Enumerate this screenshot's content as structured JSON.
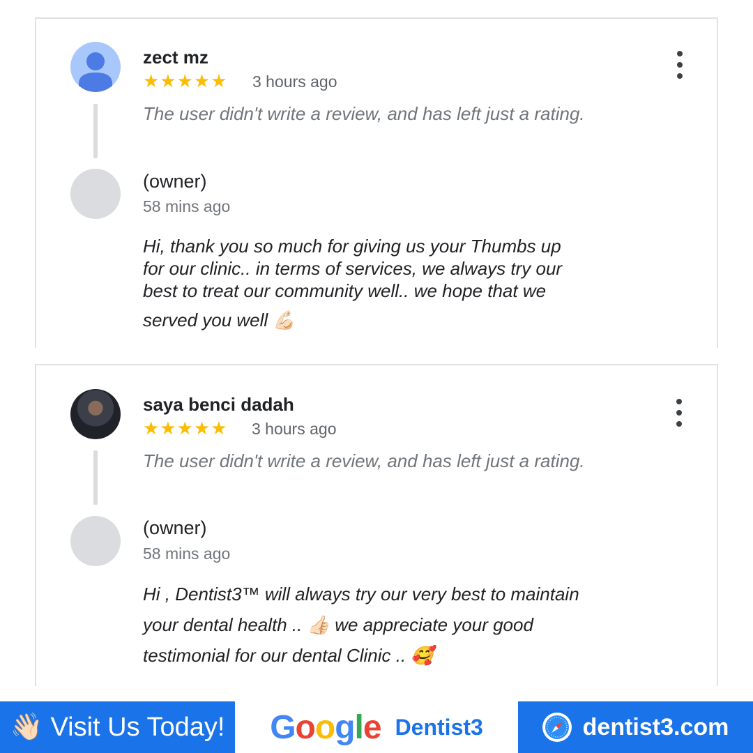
{
  "reviews": [
    {
      "reviewer_name": "zect mz",
      "stars": "★★★★★",
      "rating": 5,
      "time": "3 hours ago",
      "review_text": "The user didn't write a review, and has left just a rating.",
      "owner_label": "(owner)",
      "owner_time": "58 mins ago",
      "reply_line1": "Hi, thank you so much for giving us your Thumbs up",
      "reply_line2": "for our clinic.. in terms of services, we always try our",
      "reply_line3": "best to treat our community well.. we hope that we",
      "reply_line4": "served you well 💪🏻",
      "avatar_icon": "person-icon"
    },
    {
      "reviewer_name": "saya benci dadah",
      "stars": "★★★★★",
      "rating": 5,
      "time": "3 hours ago",
      "review_text": "The user didn't write a review, and has left just a rating.",
      "owner_label": "(owner)",
      "owner_time": "58 mins ago",
      "reply_line1": "Hi , Dentist3™ will always try our very best to maintain",
      "reply_line2": "your dental health .. 👍🏻 we appreciate your good",
      "reply_line3": "testimonial for our dental Clinic .. 🥰",
      "avatar_icon": "profile-photo"
    }
  ],
  "footer": {
    "visit_label": "👋🏻 Visit Us Today!",
    "google_letters": [
      "G",
      "o",
      "o",
      "g",
      "l",
      "e"
    ],
    "brand_name": "Dentist3",
    "website": "dentist3.com",
    "website_icon": "safari-compass-icon"
  },
  "colors": {
    "accent_blue": "#1a73e8",
    "star_yellow": "#fbbc04",
    "google_blue": "#4285f4",
    "google_red": "#ea4335",
    "google_yellow": "#fbbc05",
    "google_green": "#34a853"
  }
}
